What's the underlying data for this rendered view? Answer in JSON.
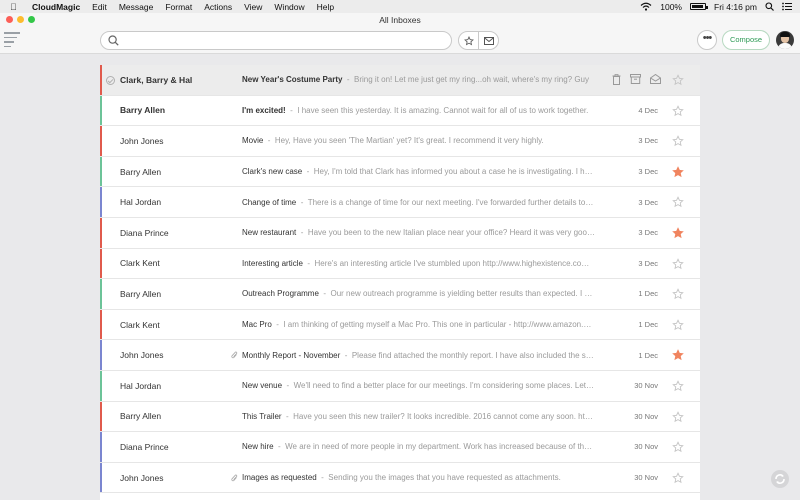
{
  "menubar": {
    "items": [
      "CloudMagic",
      "Edit",
      "Message",
      "Format",
      "Actions",
      "View",
      "Window",
      "Help"
    ],
    "battery": "100%",
    "clock": "Fri 4:16 pm"
  },
  "window": {
    "title": "All Inboxes"
  },
  "toolbar": {
    "search_placeholder": "",
    "compose_label": "Compose",
    "more_label": "•••"
  },
  "colors": {
    "accent": "#2e9a55",
    "star_active": "#f0845f",
    "star_inactive": "#c4c4c4"
  },
  "emails": [
    {
      "sender": "Clark, Barry & Hal",
      "subject": "New Year's Costume Party",
      "preview": "Bring it on! Let me just get my ring...oh wait, where's my ring? Guy",
      "date": "",
      "starred": false,
      "attachment": false,
      "selected": true,
      "unread": false,
      "color": "#e05a4c"
    },
    {
      "sender": "Barry Allen",
      "subject": "I'm excited!",
      "preview": "I have seen this yesterday. It is amazing. Cannot wait for all of us to work together.",
      "date": "4 Dec",
      "starred": false,
      "attachment": false,
      "selected": false,
      "unread": true,
      "color": "#6cc398"
    },
    {
      "sender": "John Jones",
      "subject": "Movie",
      "preview": "Hey, Have you seen 'The Martian' yet? It's great. I recommend it very highly.",
      "date": "3 Dec",
      "starred": false,
      "attachment": false,
      "selected": false,
      "unread": false,
      "color": "#e05a4c"
    },
    {
      "sender": "Barry Allen",
      "subject": "Clark's new case",
      "preview": "Hey, I'm told that Clark has informed you about a case he is investigating. I have found some more details",
      "date": "3 Dec",
      "starred": true,
      "attachment": false,
      "selected": false,
      "unread": false,
      "color": "#6cc398"
    },
    {
      "sender": "Hal Jordan",
      "subject": "Change of time",
      "preview": "There is a change of time for our next meeting. I've forwarded further details to Mr. Fox",
      "date": "3 Dec",
      "starred": false,
      "attachment": false,
      "selected": false,
      "unread": false,
      "color": "#7b86d0"
    },
    {
      "sender": "Diana Prince",
      "subject": "New restaurant",
      "preview": "Have you been to the new Italian place near your office? Heard it was very good. Sent you details",
      "date": "3 Dec",
      "starred": true,
      "attachment": false,
      "selected": false,
      "unread": false,
      "color": "#e05a4c"
    },
    {
      "sender": "Clark Kent",
      "subject": "Interesting article",
      "preview": "Here's an interesting article I've stumbled upon http://www.highexistence.com/lucid-dreaming",
      "date": "3 Dec",
      "starred": false,
      "attachment": false,
      "selected": false,
      "unread": false,
      "color": "#e05a4c"
    },
    {
      "sender": "Barry Allen",
      "subject": "Outreach Programme",
      "preview": "Our new outreach programme is yielding better results than expected. I have some numbers",
      "date": "1 Dec",
      "starred": false,
      "attachment": false,
      "selected": false,
      "unread": false,
      "color": "#6cc398"
    },
    {
      "sender": "Clark Kent",
      "subject": "Mac Pro",
      "preview": "I am thinking of getting myself a Mac Pro. This one in particular - http://www.amazon.com/Apple-Mac-Pro",
      "date": "1 Dec",
      "starred": false,
      "attachment": false,
      "selected": false,
      "unread": false,
      "color": "#e05a4c"
    },
    {
      "sender": "John Jones",
      "subject": "Monthly Report - November",
      "preview": "Please find attached the monthly report. I have also included the stats requested",
      "date": "1 Dec",
      "starred": true,
      "attachment": true,
      "selected": false,
      "unread": false,
      "color": "#7b86d0"
    },
    {
      "sender": "Hal Jordan",
      "subject": "New venue",
      "preview": "We'll need to find a better place for our meetings. I'm considering some places. Let me know",
      "date": "30 Nov",
      "starred": false,
      "attachment": false,
      "selected": false,
      "unread": false,
      "color": "#6cc398"
    },
    {
      "sender": "Barry Allen",
      "subject": "This Trailer",
      "preview": "Have you seen this new trailer? It looks incredible. 2016 cannot come any soon. https://www.youtube.com",
      "date": "30 Nov",
      "starred": false,
      "attachment": false,
      "selected": false,
      "unread": false,
      "color": "#e05a4c"
    },
    {
      "sender": "Diana Prince",
      "subject": "New hire",
      "preview": "We are in need of more people in my department. Work has increased because of the new venture",
      "date": "30 Nov",
      "starred": false,
      "attachment": false,
      "selected": false,
      "unread": false,
      "color": "#7b86d0"
    },
    {
      "sender": "John Jones",
      "subject": "Images as requested",
      "preview": "Sending you the images that you have requested as attachments.",
      "date": "30 Nov",
      "starred": false,
      "attachment": true,
      "selected": false,
      "unread": false,
      "color": "#7b86d0"
    }
  ]
}
